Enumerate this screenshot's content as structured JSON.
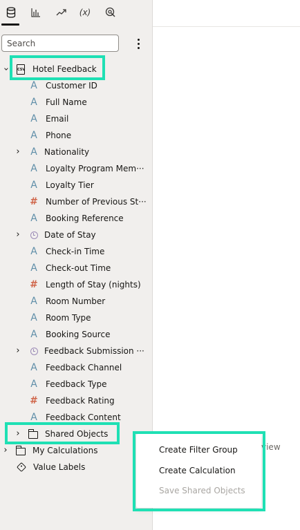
{
  "tabs": [
    {
      "name": "data-tab",
      "icon": "database-icon"
    },
    {
      "name": "visualizations-tab",
      "icon": "bar-chart-icon"
    },
    {
      "name": "analytics-tab",
      "icon": "trend-icon"
    },
    {
      "name": "calculations-tab",
      "icon": "function-icon"
    },
    {
      "name": "insights-tab",
      "icon": "insight-icon"
    }
  ],
  "tab_function_text": "(x)",
  "search": {
    "placeholder": "Search",
    "value": ""
  },
  "tree": {
    "dataset": {
      "label": "Hotel Feedback",
      "icon": "csv-file-icon",
      "icon_text": "CSV"
    },
    "columns": [
      {
        "label": "Customer ID",
        "type": "text"
      },
      {
        "label": "Full Name",
        "type": "text"
      },
      {
        "label": "Email",
        "type": "text"
      },
      {
        "label": "Phone",
        "type": "text"
      },
      {
        "label": "Nationality",
        "type": "text"
      },
      {
        "label": "Loyalty Program Mem···",
        "type": "text"
      },
      {
        "label": "Loyalty Tier",
        "type": "text"
      },
      {
        "label": "Number of Previous St···",
        "type": "number"
      },
      {
        "label": "Booking Reference",
        "type": "text"
      },
      {
        "label": "Date of Stay",
        "type": "date"
      },
      {
        "label": "Check-in Time",
        "type": "text"
      },
      {
        "label": "Check-out Time",
        "type": "text"
      },
      {
        "label": "Length of Stay (nights)",
        "type": "number"
      },
      {
        "label": "Room Number",
        "type": "text"
      },
      {
        "label": "Room Type",
        "type": "text"
      },
      {
        "label": "Booking Source",
        "type": "text"
      },
      {
        "label": "Feedback Submission ···",
        "type": "date"
      },
      {
        "label": "Feedback Channel",
        "type": "text"
      },
      {
        "label": "Feedback Type",
        "type": "text"
      },
      {
        "label": "Feedback Rating",
        "type": "number"
      },
      {
        "label": "Feedback Content",
        "type": "text"
      }
    ],
    "shared_objects": {
      "label": "Shared Objects"
    },
    "my_calculations": {
      "label": "My Calculations"
    },
    "value_labels": {
      "label": "Value Labels"
    }
  },
  "type_glyphs": {
    "text": "A",
    "number": "#"
  },
  "context_menu": {
    "items": [
      {
        "label": "Create Filter Group",
        "enabled": true
      },
      {
        "label": "Create Calculation",
        "enabled": true
      },
      {
        "label": "Save Shared Objects",
        "enabled": false
      }
    ]
  },
  "background_text": "view",
  "colors": {
    "highlight": "#1fe0b4",
    "text_type_icon": "#5f8ea8",
    "number_type_icon": "#d0664a",
    "date_type_icon": "#9b8ab6"
  }
}
